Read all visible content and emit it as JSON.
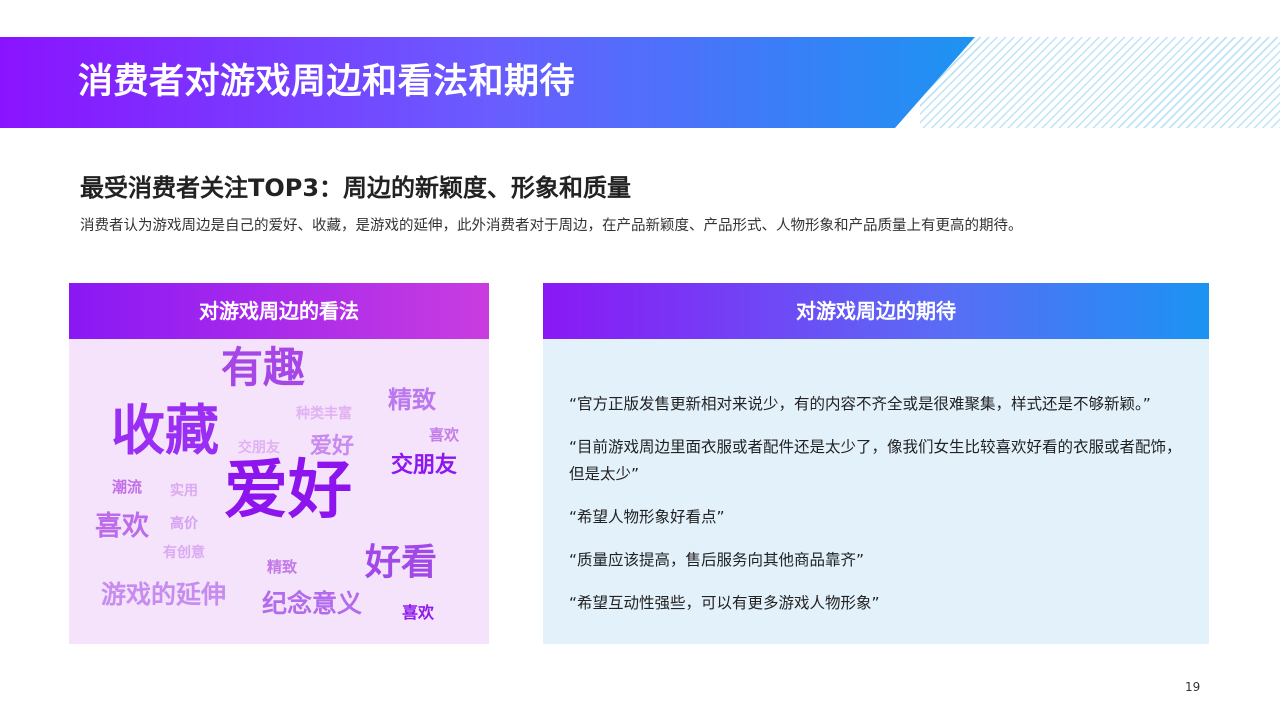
{
  "header": {
    "title": "消费者对游戏周边和看法和期待"
  },
  "subtitle": "最受消费者关注TOP3：周边的新颖度、形象和质量",
  "description": "消费者认为游戏周边是自己的爱好、收藏，是游戏的延伸，此外消费者对于周边，在产品新颖度、产品形式、人物形象和产品质量上有更高的期待。",
  "left_panel": {
    "title": "对游戏周边的看法",
    "words": [
      {
        "text": "有趣",
        "color": "#a646e6"
      },
      {
        "text": "收藏",
        "color": "#9a2ef2"
      },
      {
        "text": "种类丰富",
        "color": "#e2b1f3"
      },
      {
        "text": "精致",
        "color": "#bb77ee"
      },
      {
        "text": "交朋友",
        "color": "#e2b1f3"
      },
      {
        "text": "爱好",
        "color": "#c98af0"
      },
      {
        "text": "喜欢",
        "color": "#c57ee9"
      },
      {
        "text": "交朋友",
        "color": "#8c17ef"
      },
      {
        "text": "潮流",
        "color": "#c36ee8"
      },
      {
        "text": "实用",
        "color": "#dcaaf2"
      },
      {
        "text": "爱好",
        "color": "#8e14ee"
      },
      {
        "text": "喜欢",
        "color": "#bc6bea"
      },
      {
        "text": "高价",
        "color": "#d7a2f1"
      },
      {
        "text": "有创意",
        "color": "#dcaaf2"
      },
      {
        "text": "好看",
        "color": "#a149e8"
      },
      {
        "text": "精致",
        "color": "#c27ae9"
      },
      {
        "text": "游戏的延伸",
        "color": "#c78cef"
      },
      {
        "text": "纪念意义",
        "color": "#b26bed"
      },
      {
        "text": "喜欢",
        "color": "#8f18ee"
      }
    ]
  },
  "right_panel": {
    "title": "对游戏周边的期待",
    "quotes": [
      "“官方正版发售更新相对来说少，有的内容不齐全或是很难聚集，样式还是不够新颖。”",
      "“目前游戏周边里面衣服或者配件还是太少了，像我们女生比较喜欢好看的衣服或者配饰，但是太少”",
      "“希望人物形象好看点”",
      "“质量应该提高，售后服务向其他商品靠齐”",
      "“希望互动性强些，可以有更多游戏人物形象”"
    ]
  },
  "page_number": "19"
}
